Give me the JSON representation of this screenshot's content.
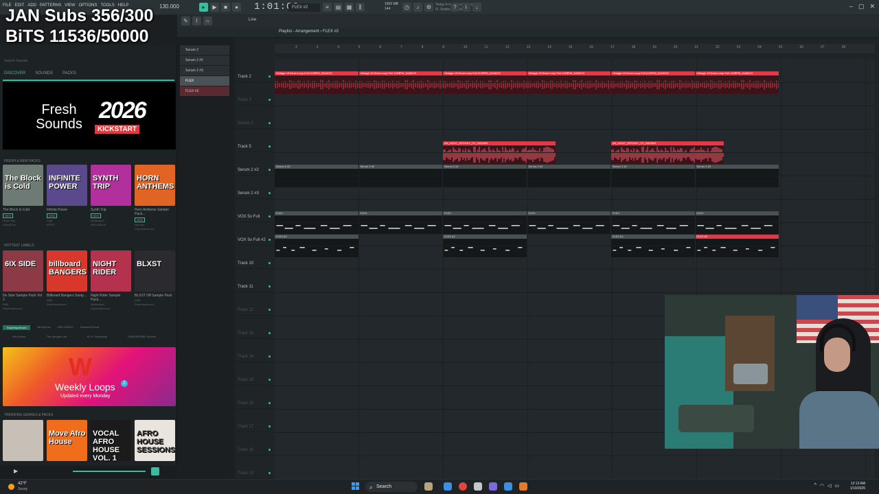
{
  "overlay": {
    "subs": "JAN Subs 356/300",
    "bits": "BiTS 11536/50000"
  },
  "topbar": {
    "menu": [
      "FILE",
      "EDIT",
      "ADD",
      "PATTERNS",
      "VIEW",
      "OPTIONS",
      "TOOLS",
      "HELP"
    ],
    "bpm": "130.000",
    "time": "1:01:00",
    "pattern": "FLEX #2",
    "perf_line1": "1665 MB",
    "perf_line2": "144",
    "update_line1": "Today  A newer version of",
    "update_line2": "FL Studio is available!",
    "snap": "Line"
  },
  "playlist": {
    "title": "Playlist - Arrangement",
    "pattern": "FLEX #2",
    "ruler": [
      "2",
      "3",
      "4",
      "5",
      "6",
      "7",
      "8",
      "9",
      "10",
      "11",
      "12",
      "13",
      "14",
      "15",
      "16",
      "17",
      "18",
      "19",
      "20",
      "21",
      "22",
      "23",
      "24",
      "25",
      "26",
      "27",
      "28"
    ],
    "tracks": [
      {
        "name": "Track 2",
        "dim": false
      },
      {
        "name": "Track 3",
        "dim": true
      },
      {
        "name": "Serum 2",
        "dim": true
      },
      {
        "name": "Track 5",
        "dim": false
      },
      {
        "name": "Serum 2 #2",
        "dim": false
      },
      {
        "name": "Serum 2 #3",
        "dim": false
      },
      {
        "name": "VOX 5o Full",
        "dim": false
      },
      {
        "name": "VOX 5o Full #2",
        "dim": false
      },
      {
        "name": "Track 10",
        "dim": false
      },
      {
        "name": "Track 11",
        "dim": false
      },
      {
        "name": "Track 12",
        "dim": true
      },
      {
        "name": "Track 13",
        "dim": true
      },
      {
        "name": "Track 14",
        "dim": true
      },
      {
        "name": "Track 15",
        "dim": true
      },
      {
        "name": "Track 16",
        "dim": true
      },
      {
        "name": "Track 17",
        "dim": true
      },
      {
        "name": "Track 18",
        "dim": true
      },
      {
        "name": "Track 19",
        "dim": true
      }
    ],
    "clip_labels": {
      "drum": "Vintage 19 Drum Loop Full 112BPM_3448219",
      "spooky": "AA_UKGC_SPOOKY_FX_3363609",
      "serum": "Serum 2 #2",
      "flex": "FLEX",
      "flex2": "FLEX #2"
    }
  },
  "channels": [
    "Serum 2",
    "Serum 2 #2",
    "Serum 2 #3",
    "FLEX",
    "FLEX #2"
  ],
  "browser": {
    "search_placeholder": "Search Sounds",
    "tabs": [
      "DISCOVER",
      "SOUNDS",
      "PACKS"
    ],
    "hero_title": "Fresh Sounds",
    "hero_year": "2026",
    "hero_kick": "KICKSTART",
    "sections": {
      "fresh": "FRESH & NEW PACKS",
      "labels": "HOTTEST LABELS",
      "trending": "TRENDING GENRES & PACKS"
    },
    "fresh_packs": [
      {
        "art": "The Block is Cold",
        "name": "The Block Is Cold",
        "badge": "NEW",
        "meta": "Boom bap\nNinetyFour",
        "color": "#6e7b74"
      },
      {
        "art": "INFINITE POWER",
        "name": "Infinite Power",
        "badge": "NEW",
        "meta": "Trap\nMSXII",
        "color": "#5a4a8c"
      },
      {
        "art": "SYNTH TRIP",
        "name": "Synth Trip",
        "badge": "NEW",
        "meta": "Synthwave\nINFLUENCE",
        "color": "#b1309b"
      },
      {
        "art": "HORN ANTHEMS",
        "name": "Horn Anthems Sample Pack...",
        "badge": "NEW",
        "meta": "Hip Hop\nDopeboyzmuzic",
        "color": "#e06524"
      }
    ],
    "label_packs": [
      {
        "art": "6IX SIDE",
        "name": "6ix Side Sample Pack Vol 3",
        "meta": "R&B\nDopeboyzmuzic",
        "color": "#8c3a45"
      },
      {
        "art": "billboard BANGERS",
        "name": "Billboard Bangers Samp...",
        "meta": "R&B\nDopeboyzmuzic",
        "color": "#d8382c"
      },
      {
        "art": "NIGHT RIDER",
        "name": "Night Rider Sample Pack...",
        "meta": "Synthwave\nDopeboyzmuzic",
        "color": "#b5324e"
      },
      {
        "art": "BLXST",
        "name": "BLXST Off Sample Pack",
        "meta": "R&B\nDopeboyzmuzic",
        "color": "#2b2b2f"
      }
    ],
    "labels_row": [
      "Dopeboyzmuzic",
      "NinetyFour",
      "INFLUENCE",
      "Samurai Sound"
    ],
    "labels_row2": [
      "Kits Kreme",
      "The Sample Lab",
      "M. A. Production",
      "UNDERGRND Sounds"
    ],
    "weekly_title": "Weekly Loops",
    "weekly_sub": "Updated every Monday",
    "weekly_count": "2",
    "trending": [
      {
        "art": "",
        "color": "#c8c0b6"
      },
      {
        "art": "Move Afro House",
        "color": "#f06d1c"
      },
      {
        "art": "VOCAL AFRO HOUSE VOL. 1",
        "color": "#1b1b1b"
      },
      {
        "art": "AFRO HOUSE SESSIONS",
        "color": "#e9e4dd"
      }
    ]
  },
  "taskbar": {
    "temp": "42°F",
    "weather": "Sunny",
    "search": "Search",
    "time": "12:13 AM",
    "date": "1/10/2026"
  },
  "colors": {
    "accent": "#3dbb9e",
    "clip_red": "#e03a48",
    "bg": "#1f2427"
  }
}
